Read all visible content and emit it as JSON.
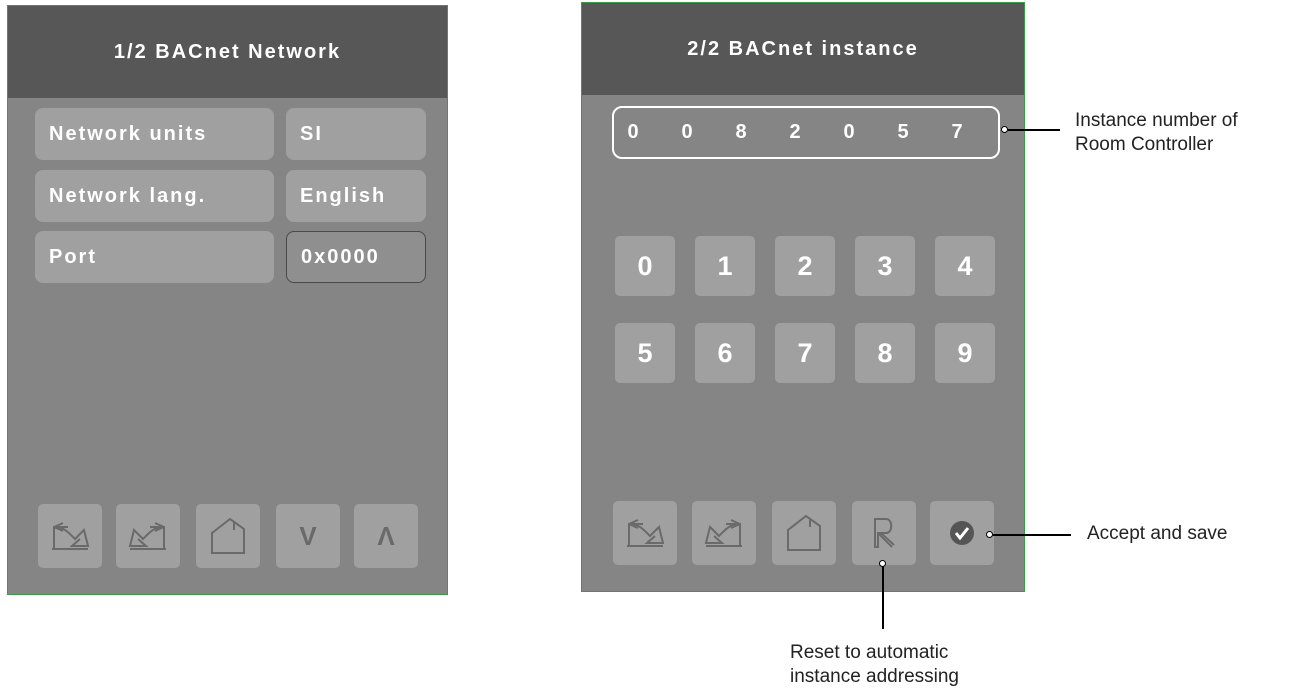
{
  "screen1": {
    "title": "1/2 BACnet Network",
    "rows": [
      {
        "label": "Network units",
        "value": "SI"
      },
      {
        "label": "Network lang.",
        "value": "English"
      },
      {
        "label": "Port",
        "value": "0x0000"
      }
    ],
    "nav_icons": [
      "back-icon",
      "forward-icon",
      "home-icon",
      "down-chevron-icon",
      "up-chevron-icon"
    ],
    "down_label": "V",
    "up_label": "Λ"
  },
  "screen2": {
    "title": "2/2 BACnet instance",
    "instance_digits": [
      "0",
      "0",
      "8",
      "2",
      "0",
      "5",
      "7"
    ],
    "keypad": [
      "0",
      "1",
      "2",
      "3",
      "4",
      "5",
      "6",
      "7",
      "8",
      "9"
    ],
    "nav_icons": [
      "back-icon",
      "forward-icon",
      "home-icon",
      "reset-r-icon",
      "accept-check-icon"
    ]
  },
  "callouts": {
    "instance_line1": "Instance number of",
    "instance_line2": "Room Controller",
    "accept": "Accept and save",
    "reset_line1": "Reset to automatic",
    "reset_line2": "instance addressing"
  },
  "colors": {
    "panel": "#858585",
    "titlebar": "#575757",
    "button": "#a0a0a0",
    "border": "#3a9a4a"
  }
}
